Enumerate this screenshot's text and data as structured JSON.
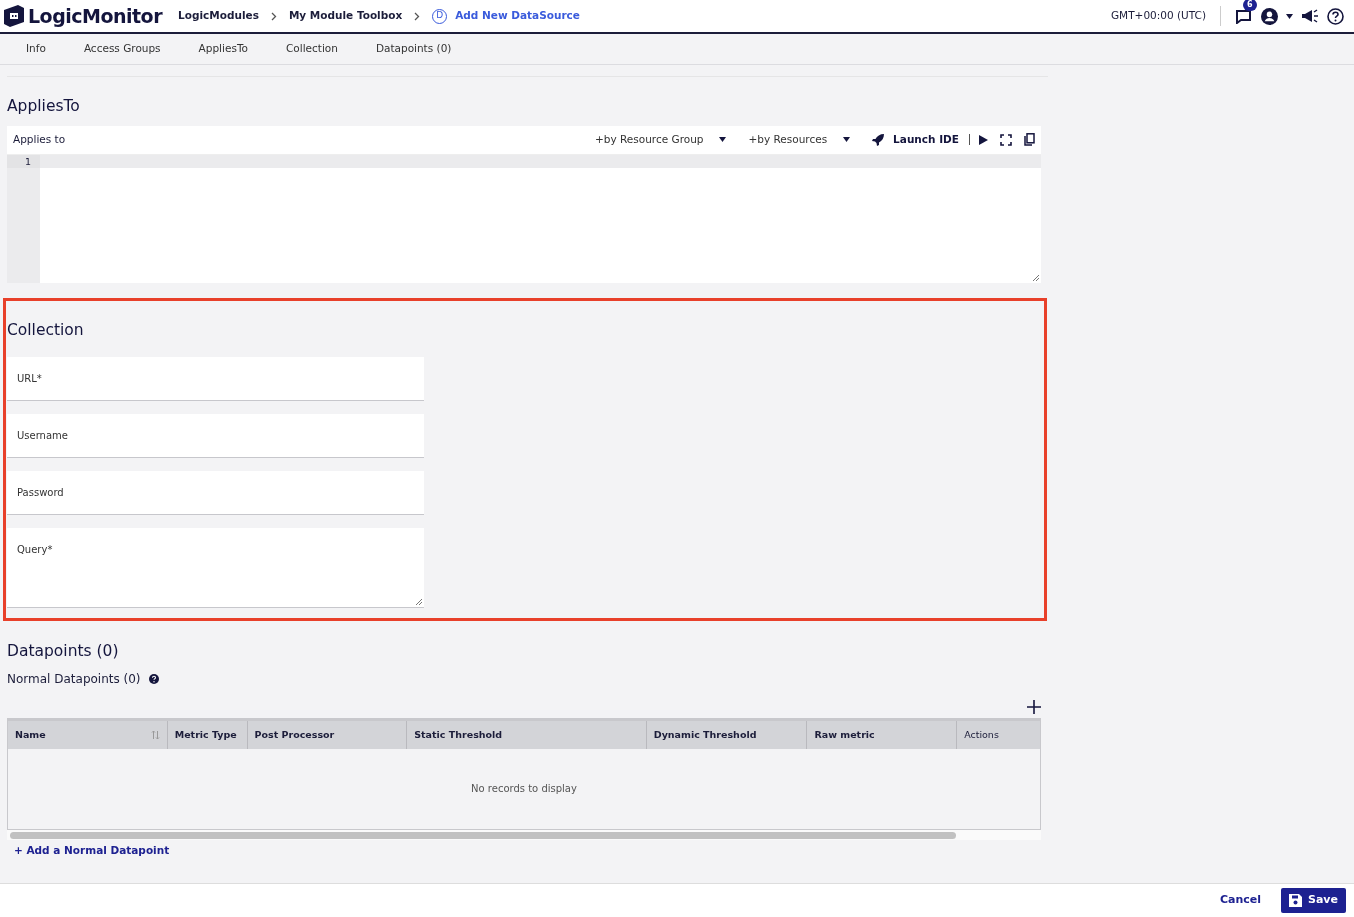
{
  "header": {
    "logo": "LogicMonitor",
    "breadcrumbs": [
      {
        "label": "LogicModules",
        "current": false
      },
      {
        "label": "My Module Toolbox",
        "current": false
      },
      {
        "label": "Add New DataSource",
        "badge": "D",
        "current": true
      }
    ],
    "timezone": "GMT+00:00 (UTC)",
    "notification_count": "6"
  },
  "tabs": [
    {
      "label": "Info",
      "selected": false
    },
    {
      "label": "Access Groups",
      "selected": false
    },
    {
      "label": "AppliesTo",
      "selected": false
    },
    {
      "label": "Collection",
      "selected": false
    },
    {
      "label": "Datapoints (0)",
      "selected": false
    }
  ],
  "applies_to": {
    "title": "AppliesTo",
    "label": "Applies to",
    "by_group": "+by Resource Group",
    "by_resources": "+by Resources",
    "launch": "Launch IDE",
    "line_numbers": [
      "1"
    ]
  },
  "collection": {
    "title": "Collection",
    "highlighted": true,
    "fields": [
      {
        "label": "URL*",
        "kind": "input"
      },
      {
        "label": "Username",
        "kind": "input"
      },
      {
        "label": "Password",
        "kind": "password"
      },
      {
        "label": "Query*",
        "kind": "textarea"
      }
    ]
  },
  "datapoints": {
    "title": "Datapoints (0)",
    "subtitle": "Normal Datapoints (0)",
    "columns": [
      {
        "label": "Name",
        "sortable": true
      },
      {
        "label": "Metric Type",
        "sortable": false
      },
      {
        "label": "Post Processor",
        "sortable": false
      },
      {
        "label": "Static Threshold",
        "sortable": false
      },
      {
        "label": "Dynamic Threshold",
        "sortable": false
      },
      {
        "label": "Raw metric",
        "sortable": false
      },
      {
        "label": "Actions",
        "sortable": false
      }
    ],
    "empty_text": "No records to display",
    "add_link": "+ Add a Normal Datapoint"
  },
  "footer": {
    "cancel": "Cancel",
    "save": "Save"
  }
}
